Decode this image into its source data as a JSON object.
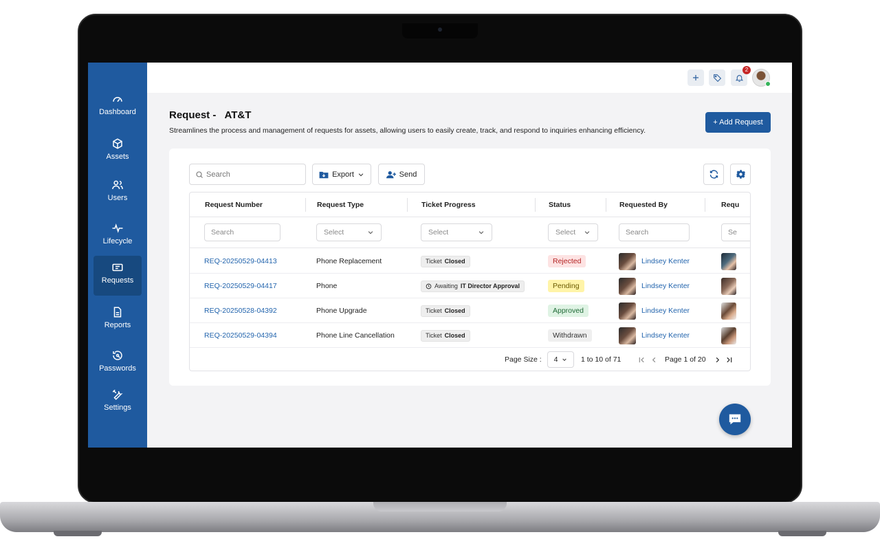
{
  "sidebar": {
    "items": [
      {
        "label": "Dashboard",
        "icon": "gauge-icon"
      },
      {
        "label": "Assets",
        "icon": "cube-icon"
      },
      {
        "label": "Users",
        "icon": "users-icon"
      },
      {
        "label": "Lifecycle",
        "icon": "pulse-icon"
      },
      {
        "label": "Requests",
        "icon": "ticket-icon",
        "active": true
      },
      {
        "label": "Reports",
        "icon": "document-icon"
      },
      {
        "label": "Passwords",
        "icon": "key-reset-icon"
      },
      {
        "label": "Settings",
        "icon": "tools-icon"
      }
    ]
  },
  "topbar": {
    "notification_count": "2"
  },
  "page": {
    "title": "Request -",
    "company": "AT&T",
    "description": "Streamlines the process and management of requests for assets, allowing users to easily create, track, and respond to inquiries enhancing efficiency.",
    "add_button": "+ Add Request"
  },
  "toolbar": {
    "search_placeholder": "Search",
    "export_label": "Export",
    "send_label": "Send"
  },
  "table": {
    "headers": [
      "Request Number",
      "Request Type",
      "Ticket Progress",
      "Status",
      "Requested By",
      "Requ"
    ],
    "filters": {
      "search_placeholder": "Search",
      "select_placeholder": "Select",
      "partial_placeholder": "Se"
    },
    "rows": [
      {
        "number": "REQ-20250529-04413",
        "type": "Phone Replacement",
        "progress_prefix": "Ticket",
        "progress_bold": "Closed",
        "progress_clock": false,
        "status": "Rejected",
        "requested_by": "Lindsey Kenter"
      },
      {
        "number": "REQ-20250529-04417",
        "type": "Phone",
        "progress_prefix": "Awaiting",
        "progress_bold": "IT Director Approval",
        "progress_clock": true,
        "status": "Pending",
        "requested_by": "Lindsey Kenter"
      },
      {
        "number": "REQ-20250528-04392",
        "type": "Phone Upgrade",
        "progress_prefix": "Ticket",
        "progress_bold": "Closed",
        "progress_clock": false,
        "status": "Approved",
        "requested_by": "Lindsey Kenter"
      },
      {
        "number": "REQ-20250529-04394",
        "type": "Phone Line Cancellation",
        "progress_prefix": "Ticket",
        "progress_bold": "Closed",
        "progress_clock": false,
        "status": "Withdrawn",
        "requested_by": "Lindsey Kenter"
      }
    ]
  },
  "pagination": {
    "page_size_label": "Page Size :",
    "page_size": "4",
    "range": "1 to 10 of 71",
    "page_label": "Page 1 of 20"
  },
  "colors": {
    "brand": "#1f5a9f",
    "link": "#2264ad",
    "rejected_bg": "#fde3e3",
    "rejected_fg": "#b42323",
    "pending_bg": "#fff4a8",
    "pending_fg": "#6b5a00",
    "approved_bg": "#dff3e4",
    "approved_fg": "#1f6a36",
    "withdrawn_bg": "#efefef",
    "withdrawn_fg": "#333333"
  }
}
